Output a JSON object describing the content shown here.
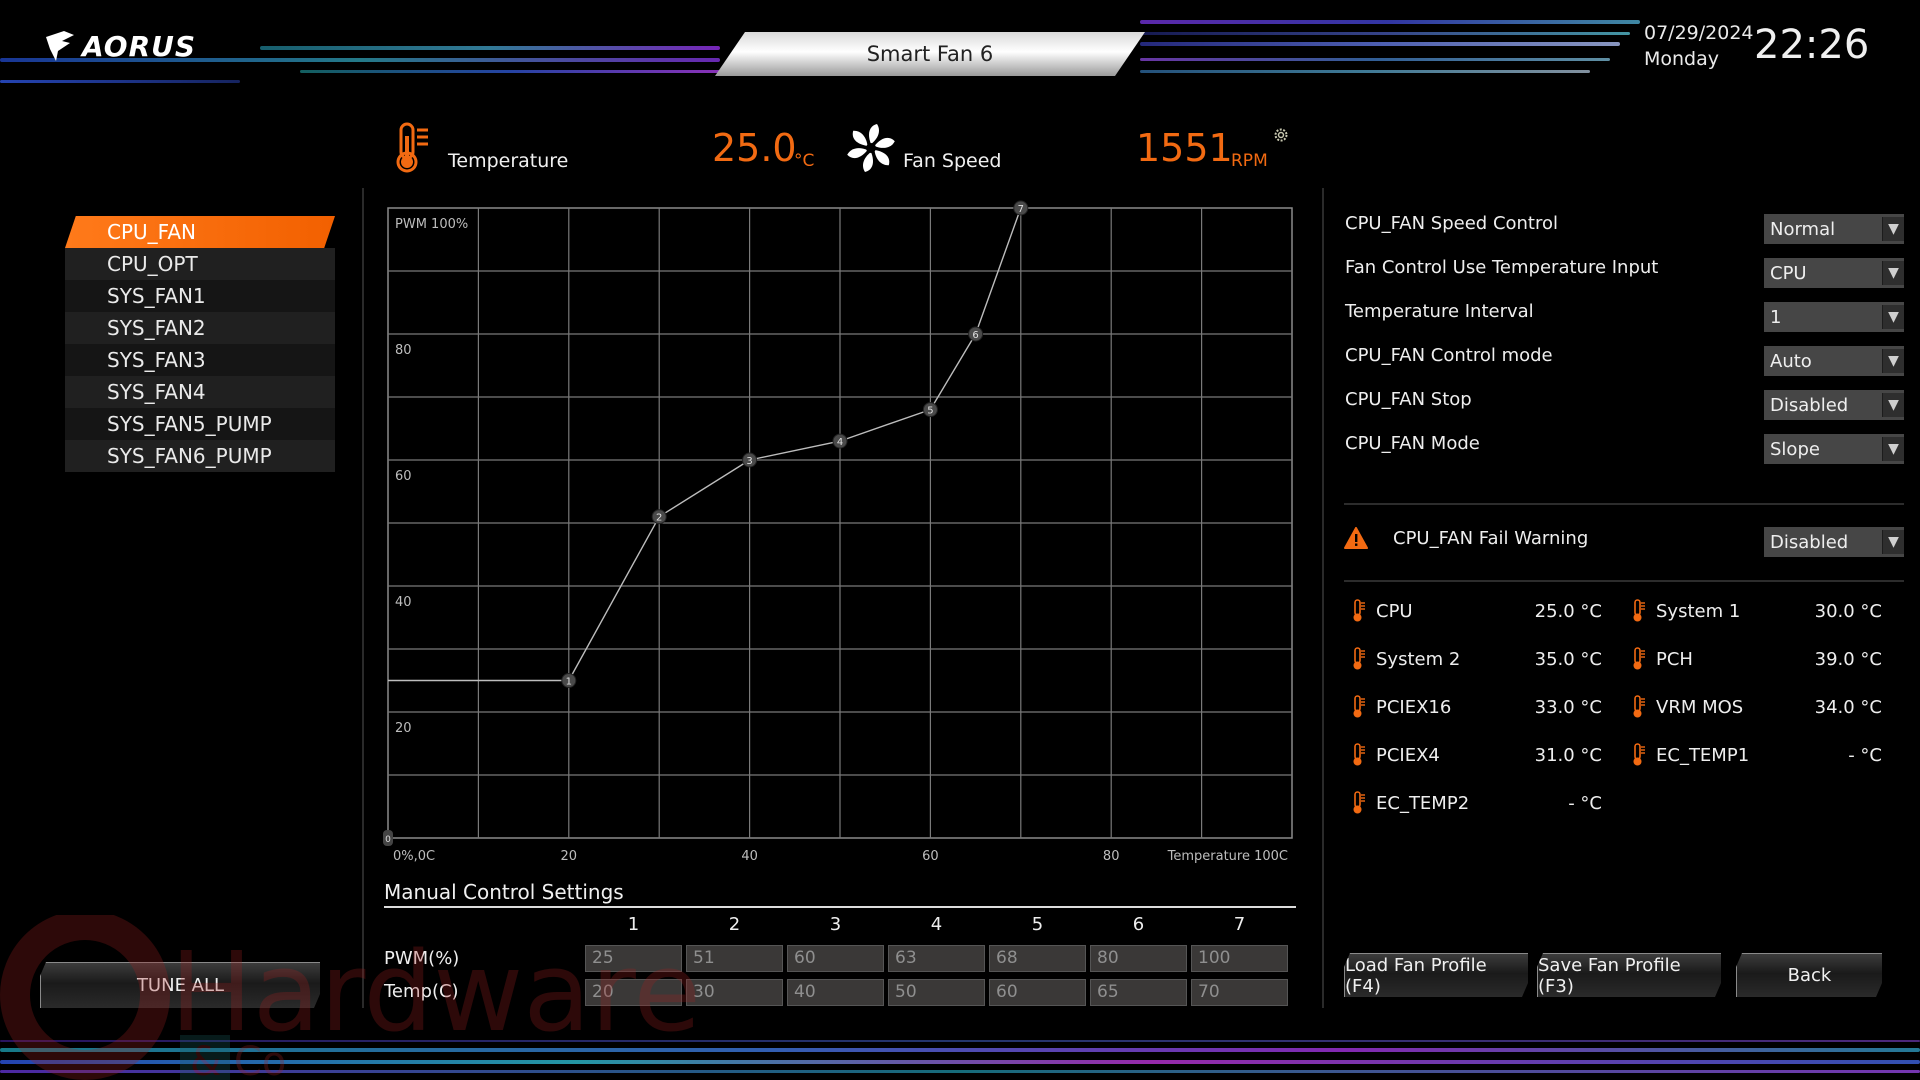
{
  "header": {
    "brand": "AORUS",
    "title": "Smart Fan 6",
    "date": "07/29/2024",
    "weekday": "Monday",
    "time": "22:26"
  },
  "readouts": {
    "temperature_label": "Temperature",
    "temperature_value": "25.0",
    "temperature_unit": "°C",
    "fan_speed_label": "Fan Speed",
    "fan_speed_value": "1551",
    "fan_speed_unit": "RPM"
  },
  "fans": [
    {
      "label": "CPU_FAN",
      "active": true
    },
    {
      "label": "CPU_OPT",
      "active": false
    },
    {
      "label": "SYS_FAN1",
      "active": false
    },
    {
      "label": "SYS_FAN2",
      "active": false
    },
    {
      "label": "SYS_FAN3",
      "active": false
    },
    {
      "label": "SYS_FAN4",
      "active": false
    },
    {
      "label": "SYS_FAN5_PUMP",
      "active": false
    },
    {
      "label": "SYS_FAN6_PUMP",
      "active": false
    }
  ],
  "tune_all_label": "TUNE ALL",
  "chart_data": {
    "type": "line",
    "title": "",
    "xlabel": "Temperature 100C",
    "ylabel": "PWM 100%",
    "origin_label": "0%,0C",
    "xlim": [
      0,
      100
    ],
    "ylim": [
      0,
      100
    ],
    "grid": true,
    "x_ticks": [
      20,
      40,
      60,
      80
    ],
    "y_ticks": [
      20,
      40,
      60,
      80
    ],
    "x_gridlines": [
      10,
      20,
      30,
      40,
      50,
      60,
      70,
      80,
      90
    ],
    "y_gridlines": [
      10,
      20,
      30,
      40,
      50,
      60,
      70,
      80,
      90
    ],
    "origin_point": {
      "label": "0",
      "x": 0,
      "y": 0
    },
    "points": [
      {
        "label": "1",
        "x": 20,
        "y": 25
      },
      {
        "label": "2",
        "x": 30,
        "y": 51
      },
      {
        "label": "3",
        "x": 40,
        "y": 60
      },
      {
        "label": "4",
        "x": 50,
        "y": 63
      },
      {
        "label": "5",
        "x": 60,
        "y": 68
      },
      {
        "label": "6",
        "x": 65,
        "y": 80
      },
      {
        "label": "7",
        "x": 70,
        "y": 100
      }
    ]
  },
  "manual": {
    "title": "Manual Control Settings",
    "columns": [
      "1",
      "2",
      "3",
      "4",
      "5",
      "6",
      "7"
    ],
    "pwm_label": "PWM(%)",
    "temp_label": "Temp(C)",
    "pwm": [
      "25",
      "51",
      "60",
      "63",
      "68",
      "80",
      "100"
    ],
    "temp": [
      "20",
      "30",
      "40",
      "50",
      "60",
      "65",
      "70"
    ]
  },
  "settings": [
    {
      "label": "CPU_FAN Speed Control",
      "value": "Normal"
    },
    {
      "label": "Fan Control Use Temperature Input",
      "value": "CPU"
    },
    {
      "label": "Temperature Interval",
      "value": "1"
    },
    {
      "label": "CPU_FAN Control mode",
      "value": "Auto"
    },
    {
      "label": "CPU_FAN Stop",
      "value": "Disabled"
    },
    {
      "label": "CPU_FAN Mode",
      "value": "Slope"
    }
  ],
  "fail_warning": {
    "label": "CPU_FAN Fail Warning",
    "value": "Disabled"
  },
  "sensors": [
    {
      "label": "CPU",
      "value": "25.0 °C"
    },
    {
      "label": "System 1",
      "value": "30.0 °C"
    },
    {
      "label": "System 2",
      "value": "35.0 °C"
    },
    {
      "label": "PCH",
      "value": "39.0 °C"
    },
    {
      "label": "PCIEX16",
      "value": "33.0 °C"
    },
    {
      "label": "VRM MOS",
      "value": "34.0 °C"
    },
    {
      "label": "PCIEX4",
      "value": "31.0 °C"
    },
    {
      "label": "EC_TEMP1",
      "value": "- °C"
    },
    {
      "label": "EC_TEMP2",
      "value": "- °C"
    }
  ],
  "buttons": {
    "load": "Load Fan Profile (F4)",
    "save": "Save Fan Profile (F3)",
    "back": "Back"
  },
  "colors": {
    "accent": "#f26a12",
    "active_item": "#ff7a1a",
    "grid": "#8a8a8a",
    "dropdown_bg": "#464646"
  },
  "watermark": {
    "text_main": "Hardware",
    "text_sub": "& Co"
  }
}
